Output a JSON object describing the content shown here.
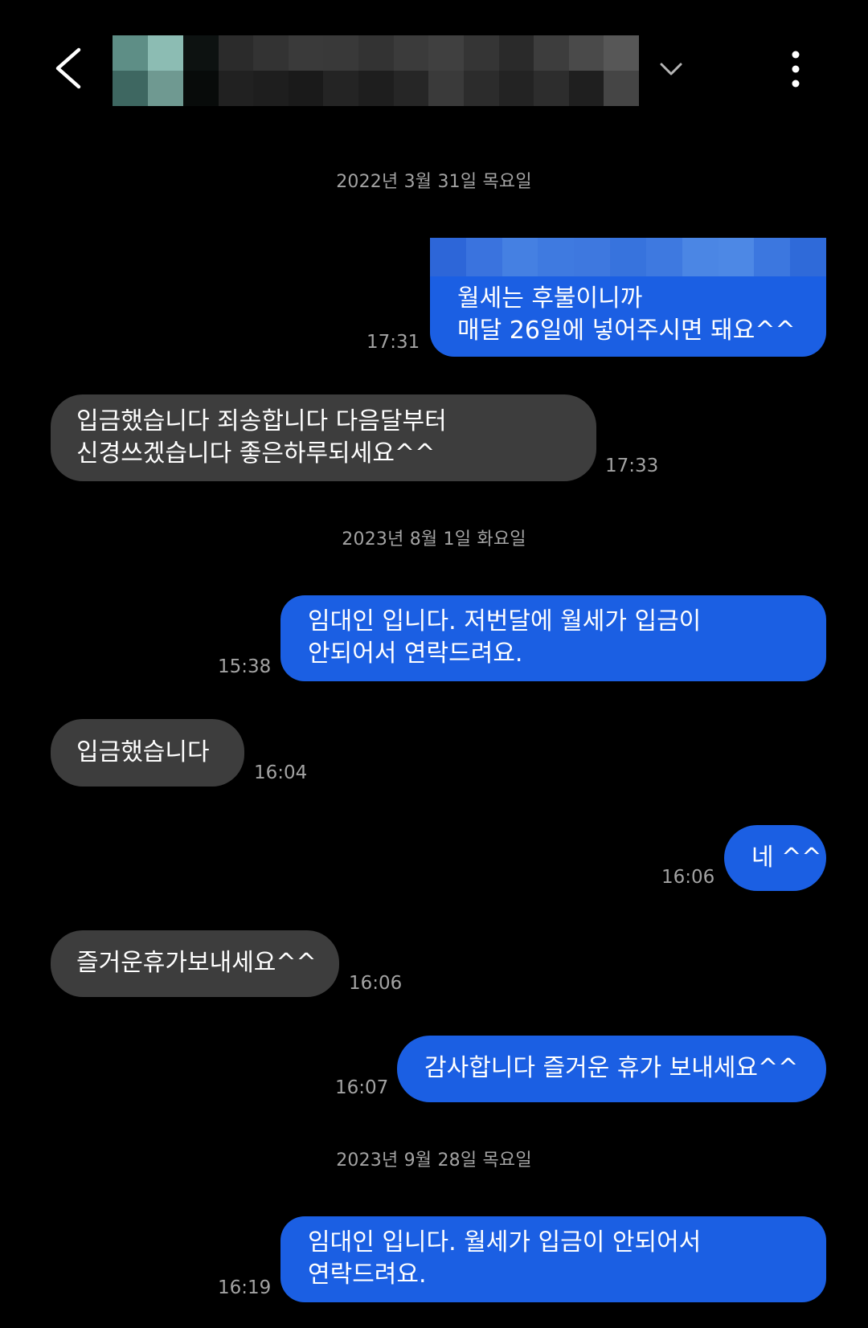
{
  "header": {
    "back_icon": "chevron-left-icon",
    "expand_icon": "chevron-down-icon",
    "menu_icon": "more-vertical-icon"
  },
  "colors": {
    "background": "#000000",
    "outgoing_bubble": "#1b5fe3",
    "incoming_bubble": "#3d3d3d",
    "meta_text": "#a3a3a3"
  },
  "dates": {
    "d1": "2022년 3월 31일 목요일",
    "d2": "2023년 8월 1일 화요일",
    "d3": "2023년 9월 28일 목요일"
  },
  "messages": [
    {
      "direction": "out",
      "lines": [
        "월세는 후불이니까",
        "매달 26일에 넣어주시면 돼요^^"
      ],
      "time": "17:31"
    },
    {
      "direction": "in",
      "lines": [
        "입금했습니다  죄송합니다 다음달부터",
        "신경쓰겠습니다 좋은하루되세요^^"
      ],
      "time": "17:33"
    },
    {
      "direction": "out",
      "lines": [
        "임대인 입니다. 저번달에 월세가 입금이",
        "안되어서 연락드려요."
      ],
      "time": "15:38"
    },
    {
      "direction": "in",
      "lines": [
        "입금했습니다"
      ],
      "time": "16:04"
    },
    {
      "direction": "out",
      "lines": [
        "네 ^^"
      ],
      "time": "16:06"
    },
    {
      "direction": "in",
      "lines": [
        "즐거운휴가보내세요^^"
      ],
      "time": "16:06"
    },
    {
      "direction": "out",
      "lines": [
        "감사합니다 즐거운 휴가 보내세요^^"
      ],
      "time": "16:07"
    },
    {
      "direction": "out",
      "lines": [
        "임대인 입니다. 월세가 입금이 안되어서",
        "연락드려요."
      ],
      "time": "16:19"
    }
  ]
}
